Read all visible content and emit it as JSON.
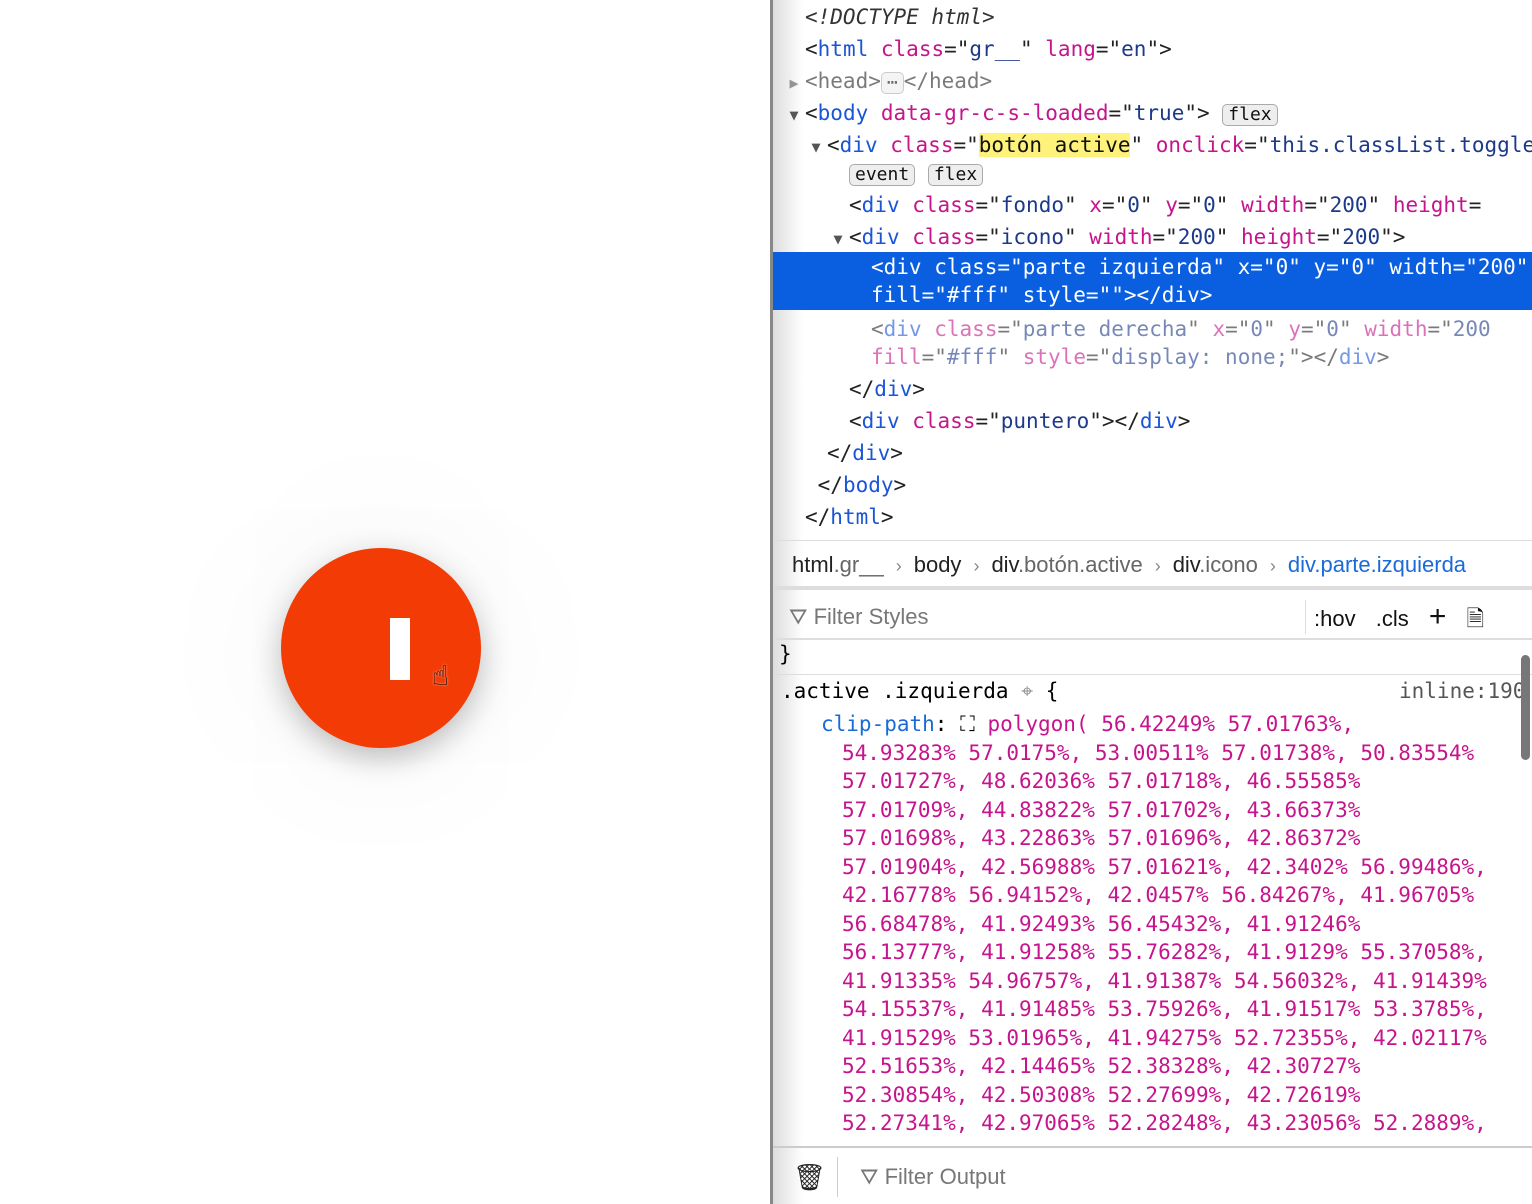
{
  "preview": {
    "button_glyph": "pause-bar",
    "accent_color": "#f33b05",
    "cursor_icon": "hand-pointer-icon"
  },
  "dom_tree": {
    "lines": [
      {
        "indent": 0,
        "twisty": "",
        "segs": [
          [
            "com",
            "<!DOCTYPE html>"
          ]
        ]
      },
      {
        "indent": 0,
        "twisty": "",
        "segs": [
          [
            "pn",
            "<"
          ],
          [
            "tag",
            "html"
          ],
          [
            "pn",
            " "
          ],
          [
            "attr",
            "class"
          ],
          [
            "pn",
            "=\""
          ],
          [
            "val",
            "gr__"
          ],
          [
            "pn",
            "\" "
          ],
          [
            "attr",
            "lang"
          ],
          [
            "pn",
            "=\""
          ],
          [
            "val",
            "en"
          ],
          [
            "pn",
            "\">"
          ]
        ]
      },
      {
        "indent": 0,
        "twisty": "▶",
        "segs": [
          [
            "pn",
            "<head>"
          ],
          [
            "badge",
            "⋯"
          ],
          [
            "pn",
            "</head>"
          ]
        ],
        "dim": true
      },
      {
        "indent": 0,
        "twisty": "▼",
        "segs": [
          [
            "pn",
            "<"
          ],
          [
            "tag",
            "body"
          ],
          [
            "pn",
            " "
          ],
          [
            "attr",
            "data-gr-c-s-loaded"
          ],
          [
            "pn",
            "=\""
          ],
          [
            "val",
            "true"
          ],
          [
            "pn",
            "\"> "
          ],
          [
            "badge",
            "flex"
          ]
        ]
      },
      {
        "indent": 1,
        "twisty": "▼",
        "segs": [
          [
            "pn",
            "<"
          ],
          [
            "tag",
            "div"
          ],
          [
            "pn",
            " "
          ],
          [
            "attr",
            "class"
          ],
          [
            "pn",
            "=\""
          ],
          [
            "hl",
            "botón active"
          ],
          [
            "pn",
            "\" "
          ],
          [
            "attr",
            "onclick"
          ],
          [
            "pn",
            "=\""
          ],
          [
            "val",
            "this.classList.toggle"
          ]
        ]
      },
      {
        "indent": 2,
        "twisty": "",
        "segs": [
          [
            "badge",
            "event"
          ],
          [
            "pn",
            " "
          ],
          [
            "badge",
            "flex"
          ]
        ]
      },
      {
        "indent": 2,
        "twisty": "",
        "segs": [
          [
            "pn",
            "<"
          ],
          [
            "tag",
            "div"
          ],
          [
            "pn",
            " "
          ],
          [
            "attr",
            "class"
          ],
          [
            "pn",
            "=\""
          ],
          [
            "val",
            "fondo"
          ],
          [
            "pn",
            "\" "
          ],
          [
            "attr",
            "x"
          ],
          [
            "pn",
            "=\""
          ],
          [
            "val",
            "0"
          ],
          [
            "pn",
            "\" "
          ],
          [
            "attr",
            "y"
          ],
          [
            "pn",
            "=\""
          ],
          [
            "val",
            "0"
          ],
          [
            "pn",
            "\" "
          ],
          [
            "attr",
            "width"
          ],
          [
            "pn",
            "=\""
          ],
          [
            "val",
            "200"
          ],
          [
            "pn",
            "\" "
          ],
          [
            "attr",
            "height"
          ],
          [
            "pn",
            "="
          ]
        ]
      },
      {
        "indent": 2,
        "twisty": "▼",
        "segs": [
          [
            "pn",
            "<"
          ],
          [
            "tag",
            "div"
          ],
          [
            "pn",
            " "
          ],
          [
            "attr",
            "class"
          ],
          [
            "pn",
            "=\""
          ],
          [
            "val",
            "icono"
          ],
          [
            "pn",
            "\" "
          ],
          [
            "attr",
            "width"
          ],
          [
            "pn",
            "=\""
          ],
          [
            "val",
            "200"
          ],
          [
            "pn",
            "\" "
          ],
          [
            "attr",
            "height"
          ],
          [
            "pn",
            "=\""
          ],
          [
            "val",
            "200"
          ],
          [
            "pn",
            "\">"
          ]
        ]
      },
      {
        "indent": 3,
        "twisty": "",
        "sel": true,
        "segs": [
          [
            "pn",
            "<div class=\"parte izquierda\" x=\"0\" y=\"0\" width=\"200\""
          ]
        ]
      },
      {
        "indent": 3,
        "twisty": "",
        "sel": true,
        "segs": [
          [
            "pn",
            "fill=\"#fff\" style=\"\"></div>"
          ]
        ]
      },
      {
        "indent": 3,
        "twisty": "",
        "dim": true,
        "segs": [
          [
            "pn",
            "<"
          ],
          [
            "tag",
            "div"
          ],
          [
            "pn",
            " "
          ],
          [
            "attr",
            "class"
          ],
          [
            "pn",
            "=\""
          ],
          [
            "val",
            "parte derecha"
          ],
          [
            "pn",
            "\" "
          ],
          [
            "attr",
            "x"
          ],
          [
            "pn",
            "=\""
          ],
          [
            "val",
            "0"
          ],
          [
            "pn",
            "\" "
          ],
          [
            "attr",
            "y"
          ],
          [
            "pn",
            "=\""
          ],
          [
            "val",
            "0"
          ],
          [
            "pn",
            "\" "
          ],
          [
            "attr",
            "width"
          ],
          [
            "pn",
            "=\""
          ],
          [
            "val",
            "200"
          ]
        ]
      },
      {
        "indent": 3,
        "twisty": "",
        "dim": true,
        "segs": [
          [
            "attr",
            "fill"
          ],
          [
            "pn",
            "=\""
          ],
          [
            "val",
            "#fff"
          ],
          [
            "pn",
            "\" "
          ],
          [
            "attr",
            "style"
          ],
          [
            "pn",
            "=\""
          ],
          [
            "val",
            "display: none;"
          ],
          [
            "pn",
            "\"></"
          ],
          [
            "tag",
            "div"
          ],
          [
            "pn",
            ">"
          ]
        ]
      },
      {
        "indent": 2,
        "twisty": "",
        "segs": [
          [
            "pn",
            "</"
          ],
          [
            "tag",
            "div"
          ],
          [
            "pn",
            ">"
          ]
        ]
      },
      {
        "indent": 2,
        "twisty": "",
        "segs": [
          [
            "pn",
            "<"
          ],
          [
            "tag",
            "div"
          ],
          [
            "pn",
            " "
          ],
          [
            "attr",
            "class"
          ],
          [
            "pn",
            "=\""
          ],
          [
            "val",
            "puntero"
          ],
          [
            "pn",
            "\"></"
          ],
          [
            "tag",
            "div"
          ],
          [
            "pn",
            ">"
          ]
        ]
      },
      {
        "indent": 1,
        "twisty": "",
        "segs": [
          [
            "pn",
            "</"
          ],
          [
            "tag",
            "div"
          ],
          [
            "pn",
            ">"
          ]
        ]
      },
      {
        "indent": 0,
        "twisty": "",
        "segs": [
          [
            "pn",
            " </"
          ],
          [
            "tag",
            "body"
          ],
          [
            "pn",
            ">"
          ]
        ]
      },
      {
        "indent": 0,
        "twisty": "",
        "segs": [
          [
            "pn",
            "</"
          ],
          [
            "tag",
            "html"
          ],
          [
            "pn",
            ">"
          ]
        ]
      }
    ]
  },
  "breadcrumbs": [
    {
      "tag": "html",
      "cls": ".gr__"
    },
    {
      "tag": "body",
      "cls": ""
    },
    {
      "tag": "div",
      "cls": ".botón.active"
    },
    {
      "tag": "div",
      "cls": ".icono"
    },
    {
      "tag": "div.parte.izquierda",
      "cls": "",
      "current": true
    }
  ],
  "styles": {
    "filter_placeholder": "Filter Styles",
    "hov": ":hov",
    "cls": ".cls",
    "add": "+",
    "close_brace": "}",
    "selector": ".active .izquierda",
    "open_brace": "{",
    "source": "inline:190",
    "property": "clip-path",
    "value_lines": [
      "polygon( 56.42249% 57.01763%,",
      "54.93283% 57.0175%, 53.00511% 57.01738%, 50.83554%",
      "57.01727%, 48.62036% 57.01718%, 46.55585%",
      "57.01709%, 44.83822% 57.01702%, 43.66373%",
      "57.01698%, 43.22863% 57.01696%, 42.86372%",
      "57.01904%, 42.56988% 57.01621%, 42.3402% 56.99486%,",
      "42.16778% 56.94152%, 42.0457% 56.84267%, 41.96705%",
      "56.68478%, 41.92493% 56.45432%, 41.91246%",
      "56.13777%, 41.91258% 55.76282%, 41.9129% 55.37058%,",
      "41.91335% 54.96757%, 41.91387% 54.56032%, 41.91439%",
      "54.15537%, 41.91485% 53.75926%, 41.91517% 53.3785%,",
      "41.91529% 53.01965%, 41.94275% 52.72355%, 42.02117%",
      "52.51653%, 42.14465% 52.38328%, 42.30727%",
      "52.30854%, 42.50308% 52.27699%, 42.72619%",
      "52.27341%, 42.97065% 52.28248%, 43.23056% 52.2889%,"
    ]
  },
  "console": {
    "filter_placeholder": "Filter Output"
  }
}
